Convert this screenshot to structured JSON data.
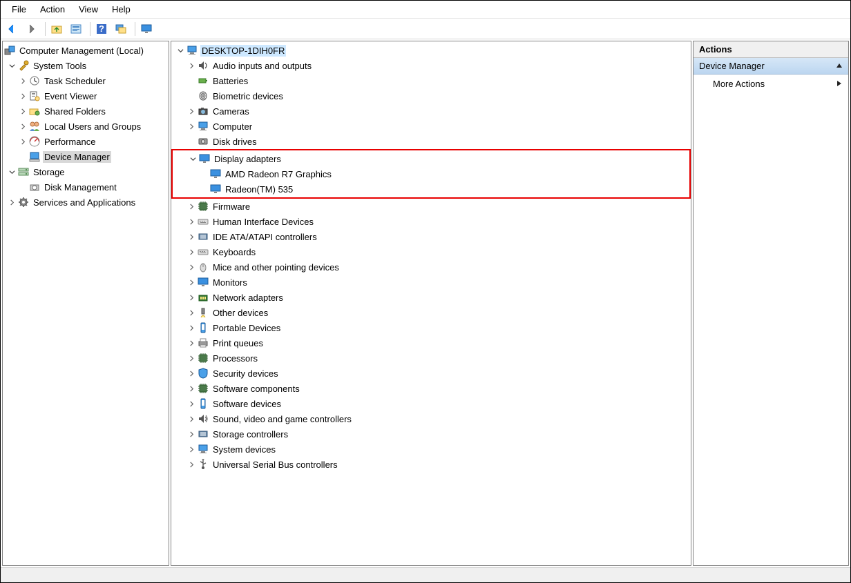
{
  "menubar": {
    "file": "File",
    "action": "Action",
    "view": "View",
    "help": "Help"
  },
  "left_tree": {
    "root": "Computer Management (Local)",
    "system_tools": "System Tools",
    "task_scheduler": "Task Scheduler",
    "event_viewer": "Event Viewer",
    "shared_folders": "Shared Folders",
    "local_users": "Local Users and Groups",
    "performance": "Performance",
    "device_manager": "Device Manager",
    "storage": "Storage",
    "disk_management": "Disk Management",
    "services_apps": "Services and Applications"
  },
  "device_tree": {
    "root": "DESKTOP-1DIH0FR",
    "audio": "Audio inputs and outputs",
    "batteries": "Batteries",
    "biometric": "Biometric devices",
    "cameras": "Cameras",
    "computer": "Computer",
    "disk_drives": "Disk drives",
    "display_adapters": "Display adapters",
    "gpu1": "AMD Radeon R7 Graphics",
    "gpu2": "Radeon(TM) 535",
    "firmware": "Firmware",
    "hid": "Human Interface Devices",
    "ide": "IDE ATA/ATAPI controllers",
    "keyboards": "Keyboards",
    "mice": "Mice and other pointing devices",
    "monitors": "Monitors",
    "network": "Network adapters",
    "other": "Other devices",
    "portable": "Portable Devices",
    "print_queues": "Print queues",
    "processors": "Processors",
    "security": "Security devices",
    "sw_components": "Software components",
    "sw_devices": "Software devices",
    "sound": "Sound, video and game controllers",
    "storage_ctrl": "Storage controllers",
    "system_devices": "System devices",
    "usb": "Universal Serial Bus controllers"
  },
  "actions": {
    "header": "Actions",
    "section": "Device Manager",
    "more": "More Actions"
  }
}
